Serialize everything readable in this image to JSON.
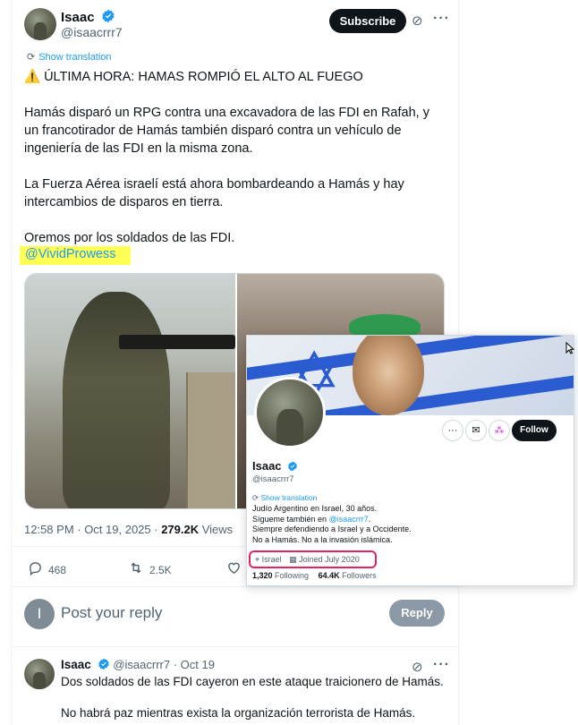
{
  "tweet": {
    "author_name": "Isaac",
    "handle": "@isaacrrr7",
    "subscribe_label": "Subscribe",
    "show_translation": "Show translation",
    "headline": "⚠️ ÚLTIMA HORA: HAMAS ROMPIÓ EL ALTO AL FUEGO",
    "paragraph1": "Hamás disparó un RPG contra una excavadora de las FDI en Rafah, y un francotirador de Hamás también disparó contra un vehículo de ingeniería de las FDI en la misma zona.",
    "paragraph2": "La Fuerza Aérea israelí está ahora bombardeando a Hamás y hay intercambios de disparos en tierra.",
    "paragraph3": "Oremos por los soldados de las FDI.",
    "mention": "@VividProwess",
    "time": "12:58 PM · Oct 19, 2025 · ",
    "views_count": "279.2K",
    "views_label": " Views",
    "replies": "468",
    "reposts": "2.5K"
  },
  "reply_box": {
    "avatar_letter": "I",
    "placeholder": "Post your reply",
    "button_label": "Reply"
  },
  "second_tweet": {
    "author_name": "Isaac",
    "meta": "@isaacrrr7 · Oct 19",
    "line1": "Dos soldados de las FDI cayeron en este ataque traicionero de Hamás.",
    "line2": "No habrá paz mientras exista la organización terrorista de Hamás."
  },
  "hover_card": {
    "name": "Isaac",
    "handle": "@isaacrrr7",
    "follow_label": "Follow",
    "show_translation": "Show translation",
    "bio_line1": "Judío Argentino en Israel, 30 años.",
    "bio_line2_prefix": "Sígueme también en ",
    "bio_line2_mention": "@isaacrrr7",
    "bio_line2_suffix": ".",
    "bio_line3": "Siempre defendiendo a Israel y a Occidente.",
    "bio_line4": "No a Hamás. No a la invasión islámica.",
    "location": "Israel",
    "joined": "Joined July 2020",
    "following_count": "1,320",
    "following_label": " Following",
    "followers_count": "64.4K",
    "followers_label": " Followers"
  },
  "colors": {
    "accent": "#1d9bf0",
    "highlight": "#ffff55",
    "info_border": "#e0245e"
  }
}
